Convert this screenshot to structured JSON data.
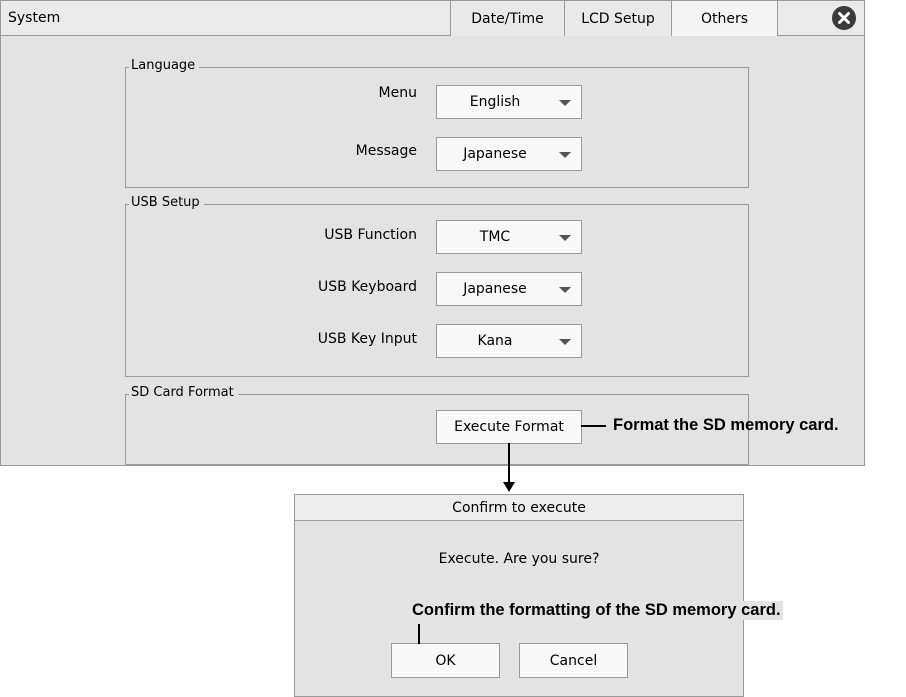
{
  "window": {
    "title": "System",
    "close_icon": "close-circle-icon"
  },
  "tabs": [
    {
      "label": "Date/Time",
      "active": false
    },
    {
      "label": "LCD Setup",
      "active": false
    },
    {
      "label": "Others",
      "active": true
    }
  ],
  "language": {
    "legend": "Language",
    "menu": {
      "label": "Menu",
      "value": "English"
    },
    "message": {
      "label": "Message",
      "value": "Japanese"
    }
  },
  "usb": {
    "legend": "USB Setup",
    "function": {
      "label": "USB Function",
      "value": "TMC"
    },
    "keyboard": {
      "label": "USB Keyboard",
      "value": "Japanese"
    },
    "key_input": {
      "label": "USB Key Input",
      "value": "Kana"
    }
  },
  "sdcard": {
    "legend": "SD Card Format",
    "execute_label": "Execute Format"
  },
  "annotations": {
    "format": "Format the SD memory card.",
    "confirm": "Confirm the formatting of the SD memory card."
  },
  "dialog": {
    "title": "Confirm to execute",
    "message": "Execute. Are you sure?",
    "ok_label": "OK",
    "cancel_label": "Cancel"
  }
}
